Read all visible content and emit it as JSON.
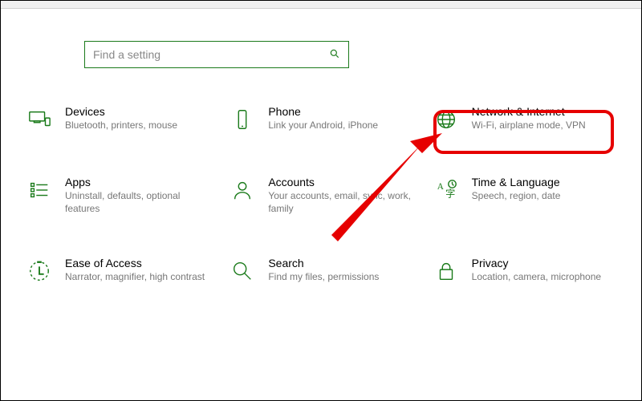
{
  "search": {
    "placeholder": "Find a setting"
  },
  "tiles": {
    "devices": {
      "title": "Devices",
      "desc": "Bluetooth, printers, mouse"
    },
    "phone": {
      "title": "Phone",
      "desc": "Link your Android, iPhone"
    },
    "network": {
      "title": "Network & Internet",
      "desc": "Wi-Fi, airplane mode, VPN"
    },
    "apps": {
      "title": "Apps",
      "desc": "Uninstall, defaults, optional features"
    },
    "accounts": {
      "title": "Accounts",
      "desc": "Your accounts, email, sync, work, family"
    },
    "time": {
      "title": "Time & Language",
      "desc": "Speech, region, date"
    },
    "ease": {
      "title": "Ease of Access",
      "desc": "Narrator, magnifier, high contrast"
    },
    "searchcat": {
      "title": "Search",
      "desc": "Find my files, permissions"
    },
    "privacy": {
      "title": "Privacy",
      "desc": "Location, camera, microphone"
    }
  },
  "icons": {
    "devices": "devices-icon",
    "phone": "phone-icon",
    "network": "globe-icon",
    "apps": "apps-list-icon",
    "accounts": "person-icon",
    "time": "time-language-icon",
    "ease": "ease-of-access-icon",
    "searchcat": "search-icon",
    "privacy": "lock-icon"
  },
  "colors": {
    "accent": "#1a7a1a",
    "annotation": "#e60000"
  }
}
